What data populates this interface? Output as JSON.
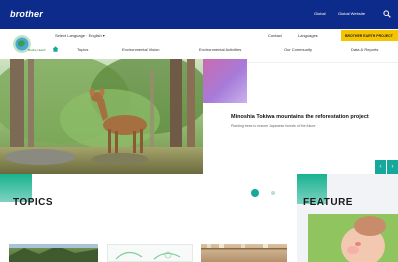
{
  "header": {
    "brand": "brother",
    "links": [
      "Global",
      "Global Website"
    ],
    "search_icon": "search-icon"
  },
  "subnav": {
    "logo_text": "Brother Earth",
    "language": "Select Language · English ▾",
    "utility": [
      "Contact",
      "Languages"
    ],
    "cta_label": "BROTHER EARTH PROJECT",
    "home_icon": "home-icon",
    "items": [
      "Topics",
      "Environmental Vision",
      "Environmental Activities",
      "Our Community",
      "Data & Reports"
    ]
  },
  "hero": {
    "title": "Minoshia Tokiwa mountains the reforestation project",
    "subtitle": "Planting trees to restore Japanese forests of the future",
    "prev_label": "‹",
    "next_label": "›"
  },
  "sections": {
    "topics_title": "TOPICS",
    "feature_title": "FEATURE"
  },
  "colors": {
    "brand_navy": "#0d2b8a",
    "accent_teal": "#16a89a",
    "cta_yellow": "#f5c400"
  }
}
